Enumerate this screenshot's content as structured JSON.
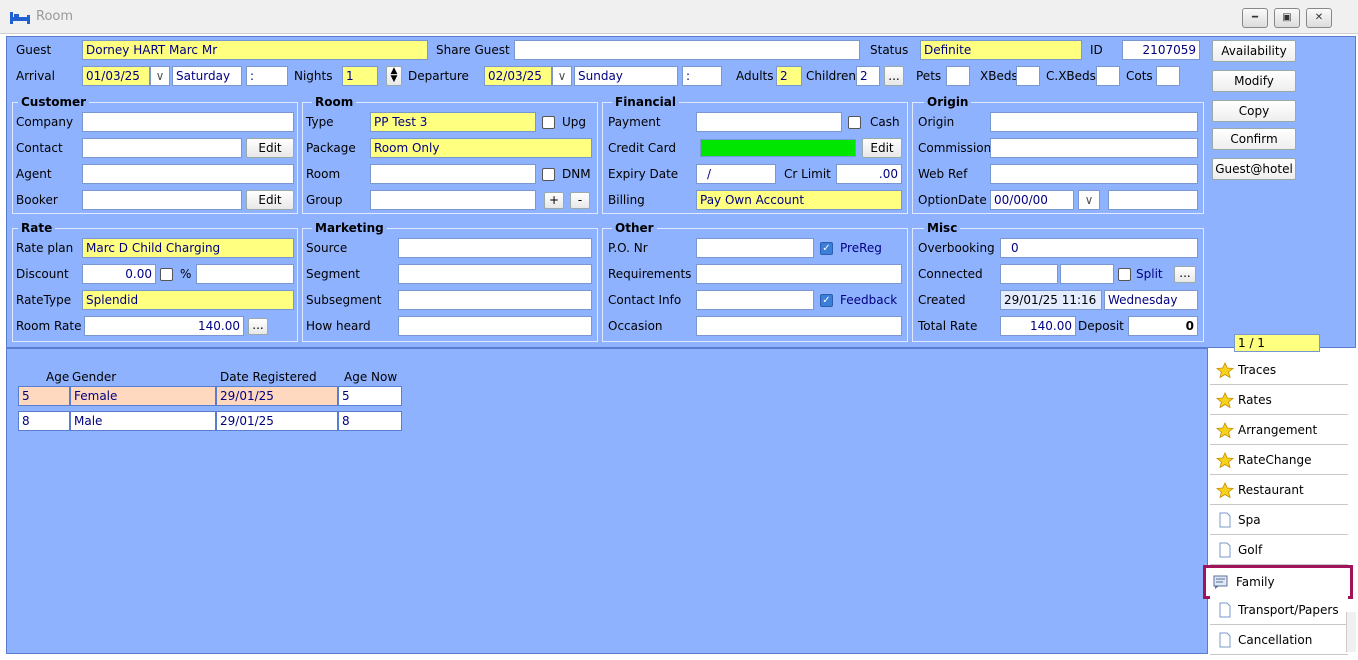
{
  "window": {
    "title": "Room"
  },
  "top": {
    "guest_label": "Guest",
    "guest_value": "Dorney HART Marc Mr",
    "share_guest_label": "Share Guest",
    "share_guest_value": "",
    "status_label": "Status",
    "status_value": "Definite",
    "id_label": "ID",
    "id_value": "2107059",
    "arrival_label": "Arrival",
    "arrival_date": "01/03/25",
    "arrival_day": "Saturday",
    "arrival_time": ":",
    "nights_label": "Nights",
    "nights_value": "1",
    "departure_label": "Departure",
    "departure_date": "02/03/25",
    "departure_day": "Sunday",
    "departure_time": ":",
    "adults_label": "Adults",
    "adults_value": "2",
    "children_label": "Children",
    "children_value": "2",
    "children_more": "...",
    "pets_label": "Pets",
    "xbeds_label": "XBeds",
    "cxbeds_label": "C.XBeds",
    "cots_label": "Cots"
  },
  "customer": {
    "title": "Customer",
    "company_label": "Company",
    "contact_label": "Contact",
    "contact_edit": "Edit",
    "agent_label": "Agent",
    "booker_label": "Booker",
    "booker_edit": "Edit"
  },
  "room": {
    "title": "Room",
    "type_label": "Type",
    "type_value": "PP Test 3",
    "upg_label": "Upg",
    "package_label": "Package",
    "package_value": "Room Only",
    "room_label": "Room",
    "dnm_label": "DNM",
    "group_label": "Group",
    "plus": "+",
    "minus": "-"
  },
  "financial": {
    "title": "Financial",
    "payment_label": "Payment",
    "cash_label": "Cash",
    "credit_card_label": "Credit Card",
    "credit_card_edit": "Edit",
    "expiry_label": "Expiry Date",
    "expiry_value": "/",
    "cr_limit_label": "Cr Limit",
    "cr_limit_value": ".00",
    "billing_label": "Billing",
    "billing_value": "Pay Own Account"
  },
  "origin": {
    "title": "Origin",
    "origin_label": "Origin",
    "commission_label": "Commission",
    "web_ref_label": "Web Ref",
    "option_date_label": "OptionDate",
    "option_date_value": "00/00/00"
  },
  "rate": {
    "title": "Rate",
    "rate_plan_label": "Rate plan",
    "rate_plan_value": "Marc D Child Charging",
    "discount_label": "Discount",
    "discount_value": "0.00",
    "percent_label": "%",
    "rate_type_label": "RateType",
    "rate_type_value": "Splendid",
    "room_rate_label": "Room Rate",
    "room_rate_value": "140.00",
    "room_rate_more": "..."
  },
  "marketing": {
    "title": "Marketing",
    "source_label": "Source",
    "segment_label": "Segment",
    "subsegment_label": "Subsegment",
    "how_heard_label": "How heard"
  },
  "other": {
    "title": "Other",
    "po_label": "P.O. Nr",
    "prereg_label": "PreReg",
    "requirements_label": "Requirements",
    "contact_info_label": "Contact Info",
    "feedback_label": "Feedback",
    "occasion_label": "Occasion"
  },
  "misc": {
    "title": "Misc",
    "overbooking_label": "Overbooking",
    "overbooking_value": "0",
    "connected_label": "Connected",
    "split_label": "Split",
    "split_more": "...",
    "created_label": "Created",
    "created_value": "29/01/25 11:16",
    "created_day": "Wednesday",
    "total_rate_label": "Total Rate",
    "total_rate_value": "140.00",
    "deposit_label": "Deposit",
    "deposit_value": "0"
  },
  "actions": {
    "availability": "Availability",
    "modify": "Modify",
    "copy": "Copy",
    "confirm": "Confirm",
    "guest_hotel": "Guest@hotel"
  },
  "pager": "1 / 1",
  "family_table": {
    "headers": {
      "age": "Age",
      "gender": "Gender",
      "date_registered": "Date Registered",
      "age_now": "Age Now"
    },
    "rows": [
      {
        "age": "5",
        "gender": "Female",
        "date_registered": "29/01/25",
        "age_now": "5"
      },
      {
        "age": "8",
        "gender": "Male",
        "date_registered": "29/01/25",
        "age_now": "8"
      }
    ]
  },
  "tabs": [
    {
      "label": "Traces",
      "icon": "star-icon"
    },
    {
      "label": "Rates",
      "icon": "star-icon"
    },
    {
      "label": "Arrangement",
      "icon": "star-icon"
    },
    {
      "label": "RateChange",
      "icon": "star-icon"
    },
    {
      "label": "Restaurant",
      "icon": "star-icon"
    },
    {
      "label": "Spa",
      "icon": "page-icon"
    },
    {
      "label": "Golf",
      "icon": "page-icon"
    },
    {
      "label": "Family",
      "icon": "family-icon"
    },
    {
      "label": "Transport/Papers",
      "icon": "page-icon"
    },
    {
      "label": "Cancellation",
      "icon": "page-icon"
    }
  ],
  "colors": {
    "panel": "#8fb2ff",
    "highlight_border": "#a0145a",
    "mandatory_field": "#ffff80",
    "credit_card_ok": "#00e600"
  }
}
